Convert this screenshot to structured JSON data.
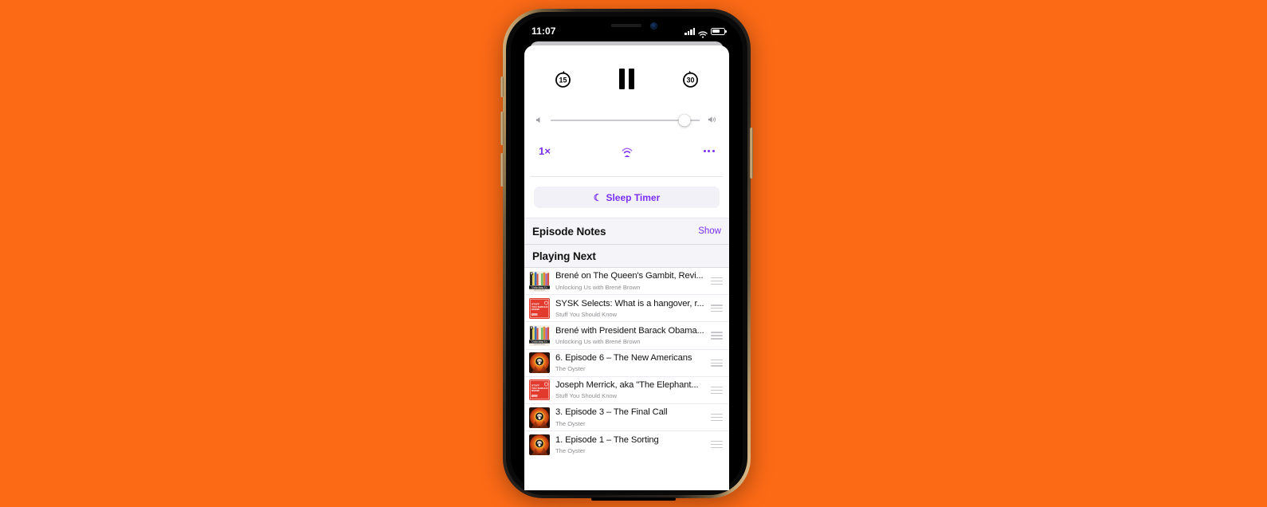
{
  "background_color": "#FC6A16",
  "accent_color": "#7b2ff7",
  "status_bar": {
    "time": "11:07",
    "cellular_icon": "cellular-bars-icon",
    "wifi_icon": "wifi-icon",
    "battery_icon": "battery-icon"
  },
  "player": {
    "skip_back_label": "15",
    "skip_back_icon": "skip-back-15-icon",
    "play_pause_icon": "pause-icon",
    "skip_forward_label": "30",
    "skip_forward_icon": "skip-forward-30-icon",
    "volume": {
      "min_icon": "volume-low-icon",
      "max_icon": "volume-high-icon",
      "value_percent": 90
    },
    "speed_label": "1×",
    "airplay_icon": "airplay-icon",
    "more_icon": "more-options-icon"
  },
  "sleep_timer": {
    "label": "Sleep Timer",
    "icon": "moon-icon",
    "glyph": "☾"
  },
  "episode_notes": {
    "title": "Episode Notes",
    "action_label": "Show"
  },
  "playing_next": {
    "title": "Playing Next",
    "items": [
      {
        "title": "Brené on The Queen's Gambit, Revi...",
        "show": "Unlocking Us with Brené Brown",
        "artwork": "unlocking-us",
        "handle_icon": "drag-handle-icon"
      },
      {
        "title": "SYSK Selects: What is a hangover, r...",
        "show": "Stuff You Should Know",
        "artwork": "sysk",
        "handle_icon": "drag-handle-icon"
      },
      {
        "title": "Brené with President Barack Obama...",
        "show": "Unlocking Us with Brené Brown",
        "artwork": "unlocking-us",
        "handle_icon": "drag-handle-icon"
      },
      {
        "title": "6. Episode 6 – The New Americans",
        "show": "The Oyster",
        "artwork": "oyster",
        "handle_icon": "drag-handle-icon"
      },
      {
        "title": "Joseph Merrick, aka \"The Elephant...",
        "show": "Stuff You Should Know",
        "artwork": "sysk",
        "handle_icon": "drag-handle-icon"
      },
      {
        "title": "3. Episode 3 – The Final Call",
        "show": "The Oyster",
        "artwork": "oyster",
        "handle_icon": "drag-handle-icon"
      },
      {
        "title": "1. Episode 1 – The Sorting",
        "show": "The Oyster",
        "artwork": "oyster",
        "handle_icon": "drag-handle-icon"
      }
    ]
  }
}
